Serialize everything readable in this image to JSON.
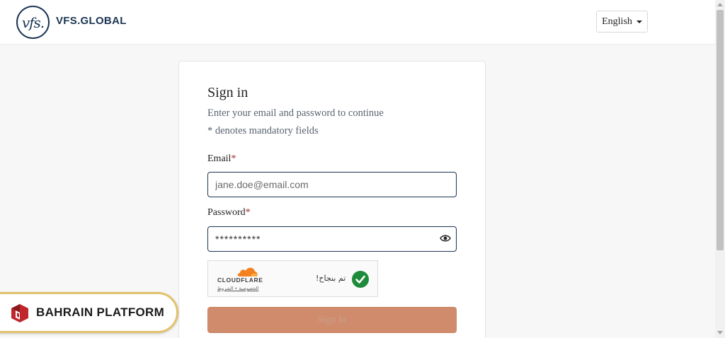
{
  "header": {
    "logo_mark": "vfs.",
    "logo_text": "VFS.GLOBAL",
    "language": "English"
  },
  "signin": {
    "title": "Sign in",
    "subtitle": "Enter your email and password to continue",
    "mandatory_note": "* denotes mandatory fields",
    "email_label": "Email",
    "email_placeholder": "jane.doe@email.com",
    "password_label": "Password",
    "password_value": "**********",
    "required_marker": "*",
    "submit_label": "Sign In"
  },
  "captcha": {
    "brand": "CLOUDFLARE",
    "links": "الخصوصية • الشروط",
    "status_text": "تم بنجاح!"
  },
  "badge": {
    "text": "BAHRAIN PLATFORM"
  },
  "colors": {
    "brand_navy": "#1c3553",
    "button_disabled": "#d08b6c",
    "required_red": "#a0282c",
    "success_green": "#1e8b3a",
    "cloudflare_orange": "#f48120",
    "badge_gold": "#e2c26d"
  }
}
